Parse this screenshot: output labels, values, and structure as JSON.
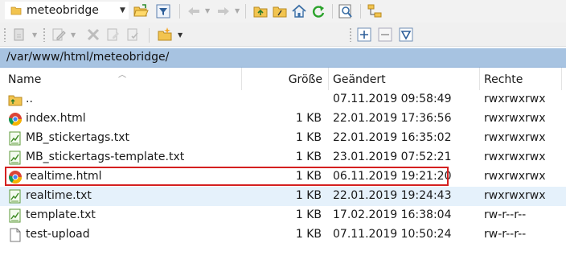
{
  "toolbar": {
    "current_folder": "meteobridge"
  },
  "path": "/var/www/html/meteobridge/",
  "columns": {
    "name": "Name",
    "size": "Größe",
    "modified": "Geändert",
    "rights": "Rechte"
  },
  "files": [
    {
      "name": "..",
      "icon": "parent-folder-icon",
      "size": "",
      "modified": "07.11.2019 09:58:49",
      "rights": "rwxrwxrwx"
    },
    {
      "name": "index.html",
      "icon": "chrome-icon",
      "size": "1 KB",
      "modified": "22.01.2019 17:36:56",
      "rights": "rwxrwxrwx"
    },
    {
      "name": "MB_stickertags.txt",
      "icon": "text-file-icon",
      "size": "1 KB",
      "modified": "22.01.2019 16:35:02",
      "rights": "rwxrwxrwx"
    },
    {
      "name": "MB_stickertags-template.txt",
      "icon": "text-file-icon",
      "size": "1 KB",
      "modified": "23.01.2019 07:52:21",
      "rights": "rwxrwxrwx"
    },
    {
      "name": "realtime.html",
      "icon": "chrome-icon",
      "size": "1 KB",
      "modified": "06.11.2019 19:21:20",
      "rights": "rwxrwxrwx",
      "highlighted": true
    },
    {
      "name": "realtime.txt",
      "icon": "text-file-icon",
      "size": "1 KB",
      "modified": "22.01.2019 19:24:43",
      "rights": "rwxrwxrwx",
      "hover": true
    },
    {
      "name": "template.txt",
      "icon": "text-file-icon",
      "size": "1 KB",
      "modified": "17.02.2019 16:38:04",
      "rights": "rw-r--r--"
    },
    {
      "name": "test-upload",
      "icon": "blank-file-icon",
      "size": "1 KB",
      "modified": "07.11.2019 10:50:24",
      "rights": "rw-r--r--"
    }
  ],
  "colors": {
    "path_bar": "#a7c3e1",
    "highlight_border": "#d42020",
    "hover_row": "#e5f1fb"
  }
}
